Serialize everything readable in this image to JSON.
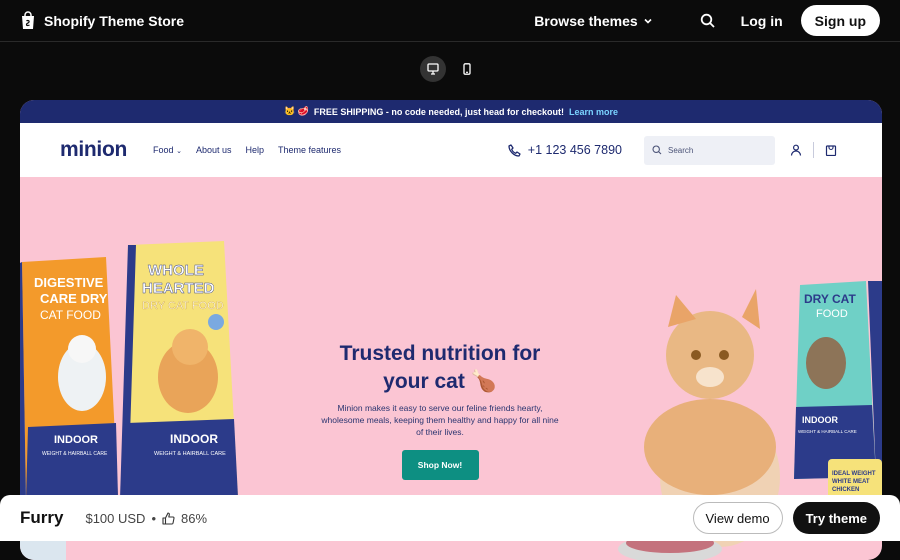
{
  "topbar": {
    "brand": "Shopify Theme Store",
    "browse": "Browse themes",
    "login": "Log in",
    "signup": "Sign up"
  },
  "devices": [
    "desktop-icon",
    "mobile-icon"
  ],
  "preview": {
    "announcement": {
      "emoji": "🐱 🥩",
      "text": "FREE SHIPPING - no code needed, just head for checkout!",
      "link": "Learn more"
    },
    "header": {
      "brand": "minion",
      "menu": [
        "Food",
        "About us",
        "Help",
        "Theme features"
      ],
      "phone": "+1 123 456 7890",
      "search_placeholder": "Search"
    },
    "hero": {
      "headline_line1": "Trusted nutrition for",
      "headline_line2": "your cat",
      "headline_emoji": "🍗",
      "body": "Minion makes it easy to serve our feline friends hearty, wholesome meals, keeping them healthy and happy for all nine of their lives.",
      "cta": "Shop Now!",
      "bags": {
        "left": {
          "line1": "DIGESTIVE",
          "line2": "CARE DRY",
          "line3": "CAT FOOD",
          "badge": "INDOOR",
          "sub": "WEIGHT & HAIRBALL CARE"
        },
        "middle": {
          "line1": "WHOLE",
          "line2": "HEARTED",
          "line3": "DRY CAT FOOD",
          "badge": "INDOOR",
          "sub": "WEIGHT & HAIRBALL CARE"
        },
        "right": {
          "line1": "DRY CAT",
          "line2": "FOOD",
          "badge": "INDOOR",
          "sub": "WEIGHT & HAIRBALL CARE"
        },
        "can": {
          "line1": "IDEAL WEIGHT",
          "line2": "WHITE MEAT",
          "line3": "CHICKEN"
        }
      },
      "colors": {
        "bg": "#fbc5d3",
        "navy": "#1e2a6f",
        "teal": "#0d8f82",
        "orange": "#f39a2b",
        "yellow": "#f6e27a"
      }
    }
  },
  "bottombar": {
    "theme_name": "Furry",
    "price": "$100 USD",
    "rating": "86%",
    "view_demo": "View demo",
    "try_theme": "Try theme"
  }
}
